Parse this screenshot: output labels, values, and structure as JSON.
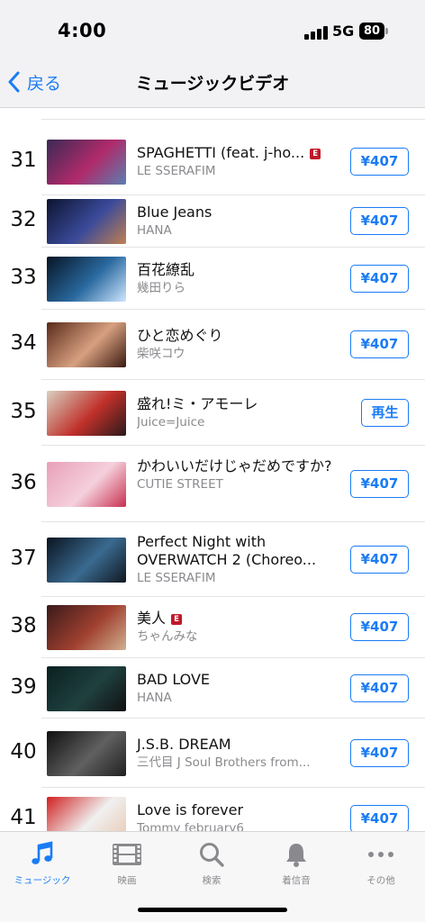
{
  "status_bar": {
    "time": "4:00",
    "network": "5G",
    "battery": "80"
  },
  "nav": {
    "back_label": "戻る",
    "title": "ミュージックビデオ"
  },
  "items": [
    {
      "rank": "31",
      "title": "SPAGHETTI (feat. j-ho...",
      "artist": "LE SSERAFIM",
      "explicit": true,
      "action": "¥407",
      "thumb": [
        "#3a2a55",
        "#b02a6a",
        "#5a7fb0"
      ]
    },
    {
      "rank": "32",
      "title": "Blue Jeans",
      "artist": "HANA",
      "explicit": false,
      "action": "¥407",
      "thumb": [
        "#0d1430",
        "#3a4a9a",
        "#c08050"
      ]
    },
    {
      "rank": "33",
      "title": "百花繚乱",
      "artist": "幾田りら",
      "explicit": false,
      "action": "¥407",
      "thumb": [
        "#061425",
        "#2a6aa0",
        "#cfe6ff"
      ]
    },
    {
      "rank": "34",
      "title": "ひと恋めぐり",
      "artist": "柴咲コウ",
      "explicit": false,
      "action": "¥407",
      "thumb": [
        "#5a2a1a",
        "#d7a080",
        "#3a1a10"
      ]
    },
    {
      "rank": "35",
      "title": "盛れ!ミ・アモーレ",
      "artist": "Juice=Juice",
      "explicit": false,
      "action": "再生",
      "thumb": [
        "#d8d0c0",
        "#c0302a",
        "#2a1a1a"
      ]
    },
    {
      "rank": "36",
      "title": "かわいいだけじゃだめですか?",
      "artist": "CUTIE STREET",
      "explicit": false,
      "action": "¥407",
      "thumb": [
        "#e8a0b8",
        "#f5d0dc",
        "#c83050"
      ]
    },
    {
      "rank": "37",
      "title": "Perfect Night with OVERWATCH 2 (Choreo...",
      "artist": "LE SSERAFIM",
      "explicit": false,
      "action": "¥407",
      "thumb": [
        "#0a1420",
        "#3a6a90",
        "#101820"
      ]
    },
    {
      "rank": "38",
      "title": "美人",
      "artist": "ちゃんみな",
      "explicit": true,
      "action": "¥407",
      "thumb": [
        "#3a1a1a",
        "#a04030",
        "#d0b090"
      ]
    },
    {
      "rank": "39",
      "title": "BAD LOVE",
      "artist": "HANA",
      "explicit": false,
      "action": "¥407",
      "thumb": [
        "#0a2020",
        "#204040",
        "#101010"
      ]
    },
    {
      "rank": "40",
      "title": "J.S.B. DREAM",
      "artist": "三代目 J Soul Brothers from...",
      "explicit": false,
      "action": "¥407",
      "thumb": [
        "#101010",
        "#606060",
        "#202020"
      ]
    },
    {
      "rank": "41",
      "title": "Love is forever",
      "artist": "Tommy february6",
      "explicit": false,
      "action": "¥407",
      "thumb": [
        "#d02020",
        "#f0f0f0",
        "#e8c8b0"
      ]
    }
  ],
  "tabs": [
    {
      "label": "ミュージック",
      "icon": "music-note-icon",
      "active": true
    },
    {
      "label": "映画",
      "icon": "film-icon",
      "active": false
    },
    {
      "label": "検索",
      "icon": "search-icon",
      "active": false
    },
    {
      "label": "着信音",
      "icon": "bell-icon",
      "active": false
    },
    {
      "label": "その他",
      "icon": "more-icon",
      "active": false
    }
  ],
  "colors": {
    "accent": "#1a7cf5",
    "explicit": "#c0192b",
    "secondary_text": "#8a8a8e"
  }
}
